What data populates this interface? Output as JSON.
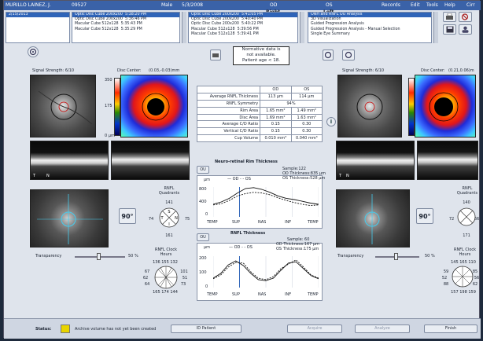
{
  "titlebar": {
    "patient": "MURILLO LAINEZ, J.",
    "id": "09527",
    "sex": "Male",
    "dob": "5/3/2008",
    "od": "OD",
    "right": "Right",
    "os": "OS",
    "left": "Left",
    "menu": [
      "Records",
      "Edit",
      "Tools",
      "Help"
    ],
    "cirrus": "Cirr"
  },
  "date_list": [
    "2/15/2013"
  ],
  "od_scans": [
    "Optic Disc Cube 200x200",
    "Optic Disc Cube 200x200",
    "Macular Cube 512x128",
    "Macular Cube 512x128"
  ],
  "od_times": [
    "5:38:20 PM",
    "5:36:46 PM",
    "5:35:43 PM",
    "5:35:29 PM"
  ],
  "os_scans": [
    "Optic Disc Cube 200x200",
    "Optic Disc Cube 200x200",
    "Optic Disc Cube 200x200",
    "Macular Cube 512x128",
    "Macular Cube 512x128"
  ],
  "os_times": [
    "5:41:05 PM",
    "5:40:40 PM",
    "5:40:22 PM",
    "5:39:56 PM",
    "5:39:41 PM"
  ],
  "analysis": [
    "ONH and RNFL OU Analysis",
    "3D Visualization",
    "Guided Progression Analysis",
    "Guided Progression Analysis - Manual Selection",
    "Single Eye Summary"
  ],
  "normative": {
    "l1": "Normative data is",
    "l2": "not available.",
    "l3": "Patient age < 18."
  },
  "od_header": {
    "signal": "Signal Strength: 6/10",
    "center": "Disc Center:",
    "center_val": "(0.03,-0.03)mm"
  },
  "os_header": {
    "signal": "Signal Strength: 6/10",
    "center": "Disc Center:",
    "center_val": "(0.21,0.06)m"
  },
  "scale": {
    "top": "350",
    "mid": "175",
    "bot": "0 µm"
  },
  "table": {
    "h_od": "OD",
    "h_os": "OS",
    "rows": [
      {
        "label": "Average RNFL Thickness",
        "od": "113 µm",
        "os": "114 µm"
      },
      {
        "label": "RNFL Symmetry",
        "both": "94%"
      },
      {
        "label": "Rim Area",
        "od": "1.65 mm²",
        "os": "1.49 mm²"
      },
      {
        "label": "Disc Area",
        "od": "1.69 mm²",
        "os": "1.63 mm²"
      },
      {
        "label": "Average C/D Ratio",
        "od": "0.15",
        "os": "0.30"
      },
      {
        "label": "Vertical C/D Ratio",
        "od": "0.15",
        "os": "0.30"
      },
      {
        "label": "Cup Volume",
        "od": "0.010 mm³",
        "os": "0.040 mm³"
      }
    ]
  },
  "ou1": "OU",
  "ou2": "OU",
  "nrim": {
    "title": "Neuro-retinal Rim Thickness",
    "sample": "Sample:122",
    "od_t": "OD Thickness:835 µm",
    "os_t": "OS Thickness:528 µm",
    "unit": "µm",
    "ticks": [
      "800",
      "400",
      "0"
    ],
    "xt": [
      "TEMP",
      "SUP",
      "NAS",
      "INF",
      "TEMP"
    ],
    "leg_od": "OD",
    "leg_os": "OS"
  },
  "rnflt": {
    "title": "RNFL Thickness",
    "sample": "Sample: 60",
    "od_t": "OD Thickness:167 µm",
    "os_t": "OS Thickness:175 µm",
    "unit": "µm",
    "ticks": [
      "200",
      "100",
      "0"
    ],
    "xt": [
      "TEMP",
      "SUP",
      "NAS",
      "INF",
      "TEMP"
    ],
    "leg_od": "OD",
    "leg_os": "OS"
  },
  "od_quad": {
    "title1": "RNFL",
    "title2": "Quadrants",
    "s": "141",
    "t": "74",
    "n": "75",
    "i": "161",
    "tl": "T",
    "nl": "N",
    "sl": "S",
    "il": "I"
  },
  "os_quad": {
    "title1": "RNFL",
    "title2": "Quadrants",
    "s": "140",
    "t": "72",
    "n": "66",
    "i": "171"
  },
  "od_clock": {
    "title1": "RNFL Clock",
    "title2": "Hours",
    "top": "136 155 132",
    "l1": "67",
    "l2": "62",
    "l3": "64",
    "r1": "101",
    "r2": "51",
    "r3": "73",
    "bot": "165 174 144"
  },
  "os_clock": {
    "title1": "RNFL Clock",
    "title2": "Hours",
    "top": "145 165 110",
    "l1": "59",
    "l2": "52",
    "l3": "88",
    "r1": "85",
    "r2": "56",
    "r3": "62",
    "bot": "157 198 159"
  },
  "angle": "90°",
  "transparency": {
    "label": "Transparency",
    "value": "50 %"
  },
  "status": {
    "label": "Status:",
    "msg": "Archive volume has not yet been created",
    "id_patient": "ID Patient",
    "acquire": "Acquire",
    "analyze": "Analyze",
    "finish": "Finish"
  },
  "colors": {
    "od": "#000000",
    "os": "#000000",
    "accent": "#2f64b8"
  }
}
